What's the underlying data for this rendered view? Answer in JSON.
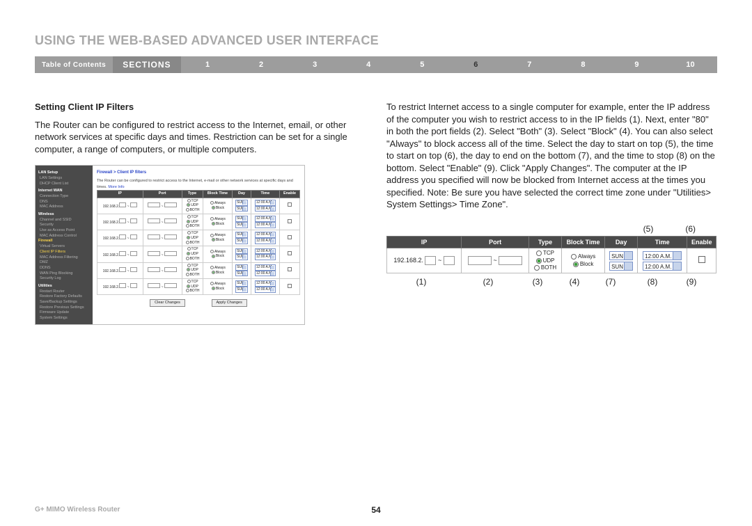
{
  "page_title": "USING THE WEB-BASED ADVANCED USER INTERFACE",
  "sections_bar": {
    "toc": "Table of Contents",
    "label": "SECTIONS",
    "numbers": [
      "1",
      "2",
      "3",
      "4",
      "5",
      "6",
      "7",
      "8",
      "9",
      "10"
    ],
    "active": "6"
  },
  "subhead": "Setting Client IP Filters",
  "left_para": "The Router can be configured to restrict access to the Internet, email, or other network services at specific days and times. Restriction can be set for a single computer, a range of computers, or multiple computers.",
  "right_para": "To restrict Internet access to a single computer for example, enter the IP address of the computer you wish to restrict access to in the IP fields (1). Next, enter \"80\" in both the port fields (2). Select \"Both\" (3). Select \"Block\" (4). You can also select \"Always\" to block access all of the time. Select the day to start on top (5), the time to start on top (6), the day to end on the bottom (7), and the time to stop (8) on the bottom. Select \"Enable\" (9). Click \"Apply Changes\". The computer at the IP address you specified will now be blocked from Internet access at the times you specified. Note: Be sure you have selected the correct time zone under \"Utilities> System Settings> Time Zone\".",
  "router_shot": {
    "breadcrumb": "Firewall > Client IP filters",
    "desc": "The Router can be configured to restrict access to the Internet, e-mail or other network services at specific days and times.",
    "more": "More Info",
    "nav": {
      "groups": [
        {
          "hdr": "LAN Setup",
          "items": [
            "LAN Settings",
            "DHCP Client List"
          ]
        },
        {
          "hdr": "Internet WAN",
          "items": [
            "Connection Type",
            "DNS",
            "MAC Address"
          ]
        },
        {
          "hdr": "Wireless",
          "items": [
            "Channel and SSID",
            "Security",
            "Use as Access Point",
            "MAC Address Control"
          ]
        },
        {
          "hdr_hl": "Firewall",
          "items": [
            "Virtual Servers"
          ],
          "active": "Client IP Filters",
          "items2": [
            "MAC Address Filtering",
            "DMZ",
            "DDNS",
            "WAN Ping Blocking",
            "Security Log"
          ]
        },
        {
          "hdr": "Utilities",
          "items": [
            "Restart Router",
            "Restore Factory Defaults",
            "Save/Backup Settings",
            "Restore Previous Settings",
            "Firmware Update",
            "System Settings"
          ]
        }
      ]
    },
    "tbl": {
      "headers": [
        "IP",
        "Port",
        "Type",
        "Block Time",
        "Day",
        "Time",
        "Enable"
      ],
      "ip_prefix": "192.168.2.",
      "type_opts": [
        "TCP",
        "UDP",
        "BOTH"
      ],
      "bt_opts": [
        "Always",
        "Block"
      ],
      "day": "SUN",
      "time": "12:00 A.M.",
      "row_count": 6
    },
    "btn_clear": "Clear Changes",
    "btn_apply": "Apply Changes"
  },
  "detail": {
    "call_top": [
      "(5)",
      "(6)"
    ],
    "call_bot": [
      "(1)",
      "(2)",
      "(3)",
      "(4)",
      "(7)",
      "(8)",
      "(9)"
    ],
    "headers": [
      "IP",
      "Port",
      "Type",
      "Block Time",
      "Day",
      "Time",
      "Enable"
    ],
    "ip_prefix": "192.168.2.",
    "type_opts": [
      "TCP",
      "UDP",
      "BOTH"
    ],
    "bt_opts": [
      "Always",
      "Block"
    ],
    "day": "SUN",
    "time": "12:00 A.M."
  },
  "footer": {
    "product": "G+ MIMO Wireless Router",
    "page": "54"
  }
}
